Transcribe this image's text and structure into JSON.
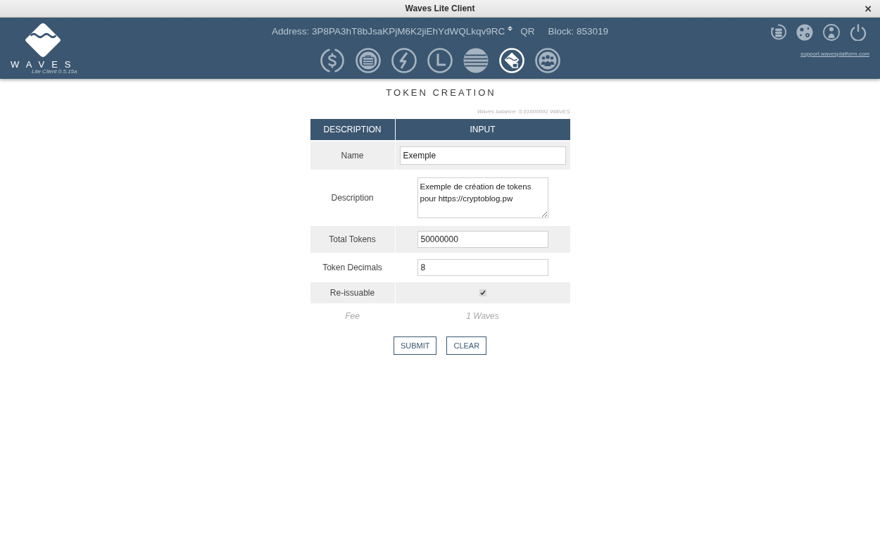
{
  "window": {
    "title": "Waves Lite Client",
    "close": "×"
  },
  "header": {
    "logo": {
      "wordmark": "WAVES",
      "version": "Lite Client 0.5.15a"
    },
    "address": "Address: 3P8PA3hT8bJsaKPjM6K2jiEhYdWQLkqv9RC",
    "qr": "QR",
    "block": "Block: 853019",
    "nav": [
      {
        "kind": "dollar",
        "selected": false
      },
      {
        "kind": "briefcase",
        "selected": false
      },
      {
        "kind": "bolt",
        "selected": false
      },
      {
        "kind": "angle",
        "selected": false
      },
      {
        "kind": "stripes",
        "selected": false
      },
      {
        "kind": "token",
        "selected": true
      },
      {
        "kind": "people",
        "selected": false
      }
    ],
    "actions": [
      {
        "kind": "database-sync"
      },
      {
        "kind": "globe"
      },
      {
        "kind": "user"
      },
      {
        "kind": "power"
      }
    ],
    "support_link": "support.wavesplatform.com"
  },
  "page": {
    "title": "TOKEN CREATION",
    "balance": "Waves balance: 5.91600091 WAVES",
    "table": {
      "columns": [
        "DESCRIPTION",
        "INPUT"
      ],
      "rows": [
        {
          "label": "Name",
          "kind": "text",
          "value": "Exemple"
        },
        {
          "label": "Description",
          "kind": "textarea",
          "value": "Exemple de création de tokens pour https://cryptoblog.pw"
        },
        {
          "label": "Total Tokens",
          "kind": "number",
          "value": "50000000"
        },
        {
          "label": "Token Decimals",
          "kind": "number",
          "value": "8"
        },
        {
          "label": "Re-issuable",
          "kind": "checkbox",
          "checked": true
        },
        {
          "label": "Fee",
          "kind": "note",
          "value": "1 Waves"
        }
      ]
    },
    "buttons": [
      "SUBMIT",
      "CLEAR"
    ]
  }
}
